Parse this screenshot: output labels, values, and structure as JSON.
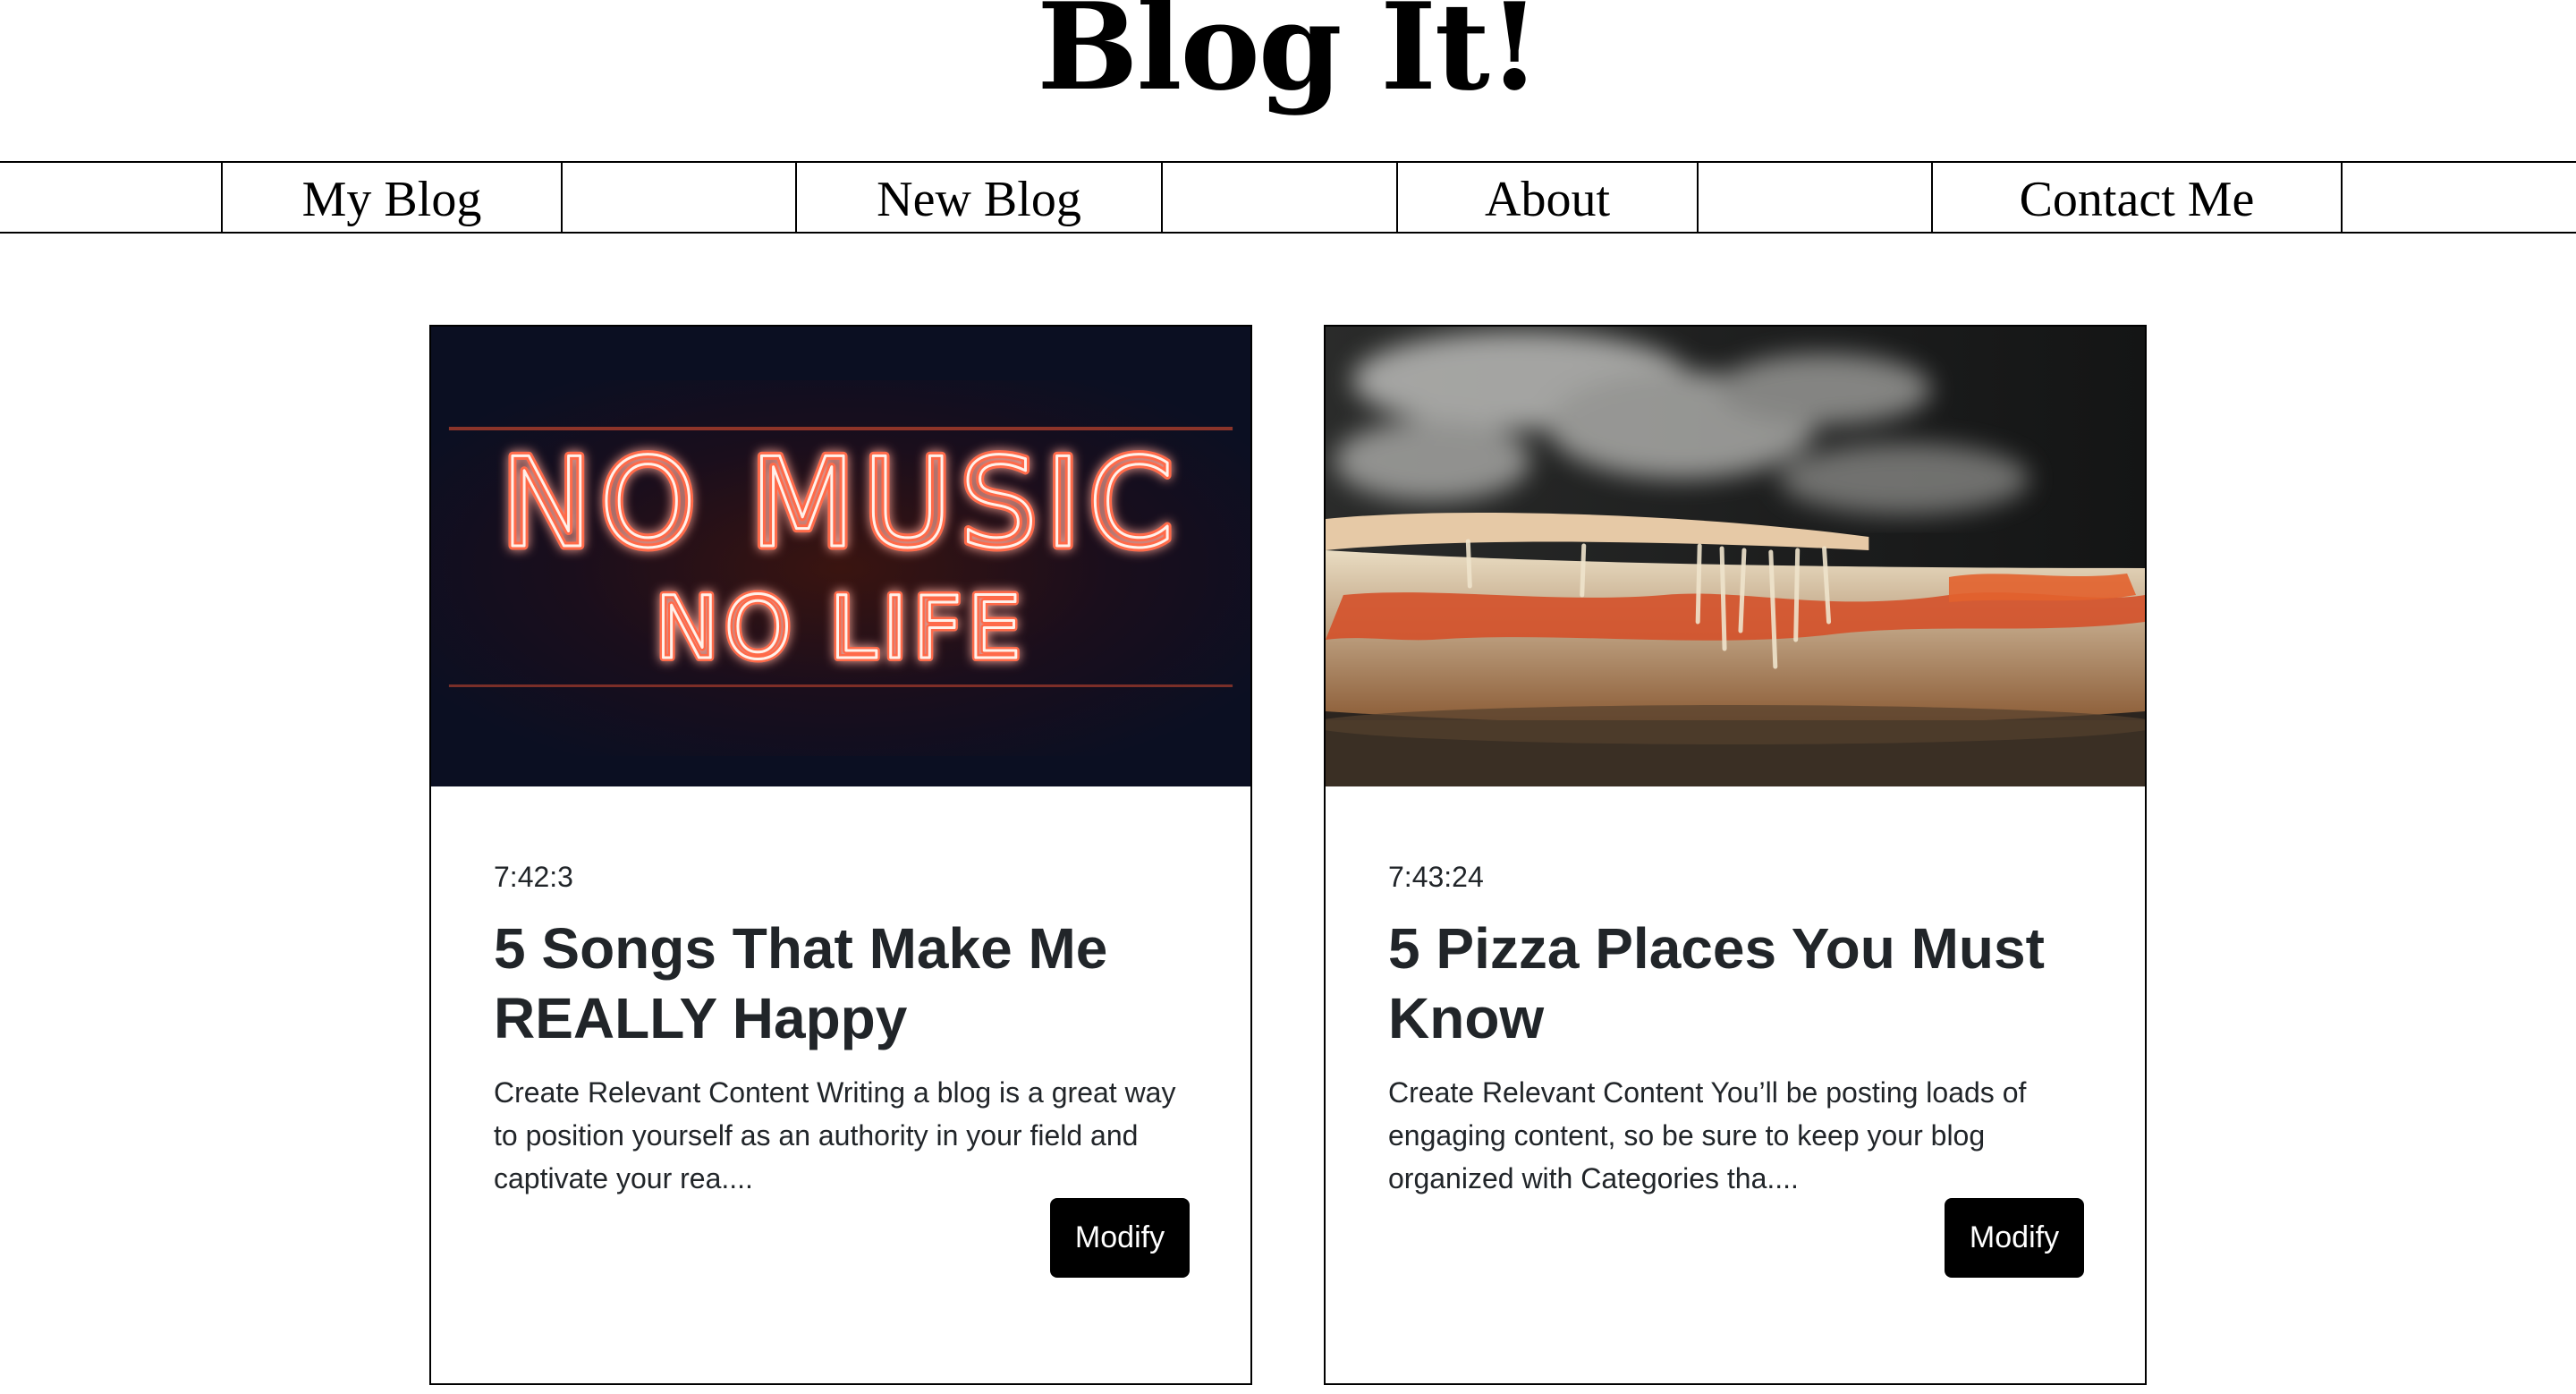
{
  "site": {
    "title": "Blog It!"
  },
  "nav": {
    "items": [
      {
        "label": "My Blog"
      },
      {
        "label": "New Blog"
      },
      {
        "label": "About"
      },
      {
        "label": "Contact Me"
      }
    ]
  },
  "posts": [
    {
      "time": "7:42:3",
      "title": "5 Songs That Make Me REALLY Happy",
      "excerpt": "Create Relevant Content Writing a blog is a great way to position yourself as an authority in your field and captivate your rea....",
      "button_label": "Modify",
      "image": {
        "subject": "neon sign",
        "sign_line_1": "NO MUSIC",
        "sign_line_2": "NO LIFE"
      }
    },
    {
      "time": "7:43:24",
      "title": "5 Pizza Places You Must Know",
      "excerpt": "Create Relevant Content You’ll be posting loads of engaging content, so be sure to keep your blog organized with Categories tha....",
      "button_label": "Modify",
      "image": {
        "subject": "steaming pizza"
      }
    }
  ],
  "colors": {
    "accent": "#000000",
    "text": "#212529",
    "neon": "#ff6a4a",
    "neon_bg": "#0b0f22"
  }
}
